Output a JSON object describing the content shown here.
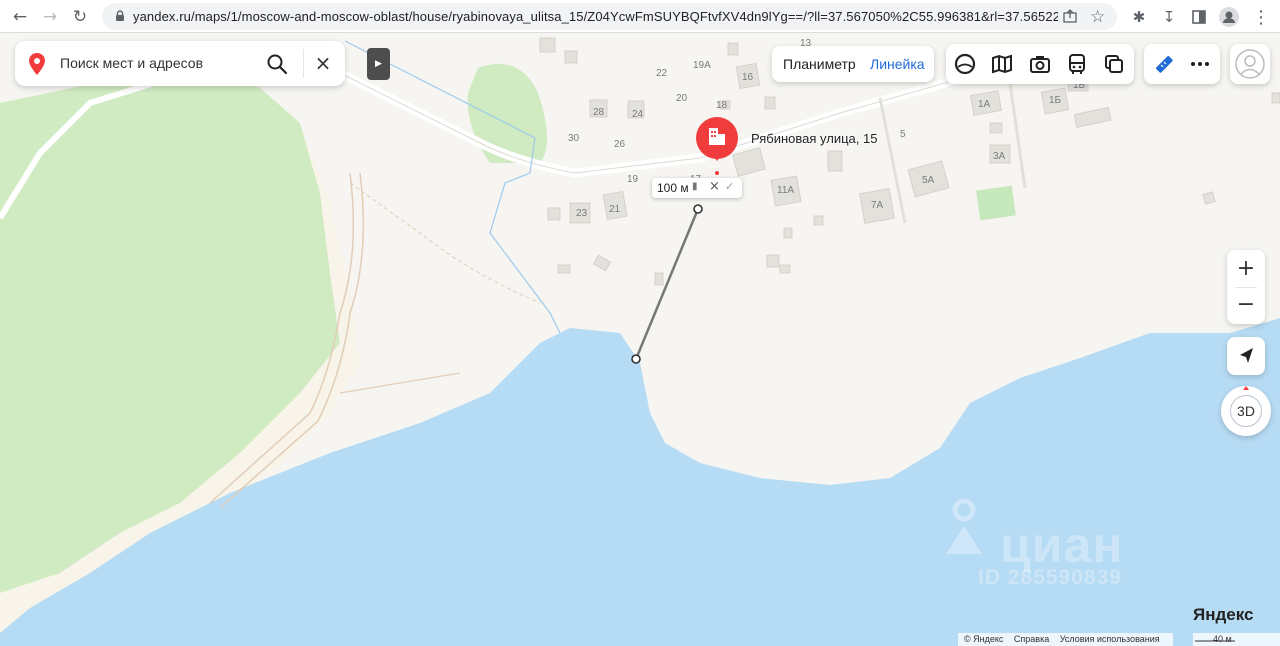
{
  "browser": {
    "url": "yandex.ru/maps/1/moscow-and-moscow-oblast/house/ryabinovaya_ulitsa_15/Z04YcwFmSUYBQFtvfXV4dn9lYg==/?ll=37.567050%2C55.996381&rl=37.56522..."
  },
  "search": {
    "placeholder": "Поиск мест и адресов"
  },
  "ruler_modes": {
    "planimeter": "Планиметр",
    "ruler": "Линейка",
    "active": "ruler"
  },
  "layers": [
    {
      "icon": "panorama-icon"
    },
    {
      "icon": "map-layers-icon"
    },
    {
      "icon": "photo-icon"
    },
    {
      "icon": "transport-icon"
    },
    {
      "icon": "layers-icon"
    }
  ],
  "place": {
    "name": "Рябиновая улица, 15"
  },
  "ruler": {
    "distance": "100 м"
  },
  "house_numbers": [
    "13",
    "22",
    "19А",
    "16",
    "20",
    "18",
    "28",
    "24",
    "30",
    "26",
    "19",
    "17",
    "23",
    "21",
    "5",
    "1А",
    "1Б",
    "1Б",
    "3А",
    "11А",
    "5А",
    "7А"
  ],
  "controls": {
    "zoom_in": "+",
    "zoom_out": "−",
    "btn_3d": "3D"
  },
  "watermark": {
    "brand": "циан",
    "id": "ID 285590839"
  },
  "footer": {
    "logo": "Яндекс",
    "copyright": "© Яндекс",
    "help": "Справка",
    "terms": "Условия использования",
    "scale": "40 м"
  },
  "colors": {
    "water": "#b6dbf4",
    "forest": "#d0ebc2",
    "land": "#f6f5f1",
    "shore": "#f8f4ea",
    "pin": "#f03c3c",
    "accent": "#1f6cd6"
  }
}
